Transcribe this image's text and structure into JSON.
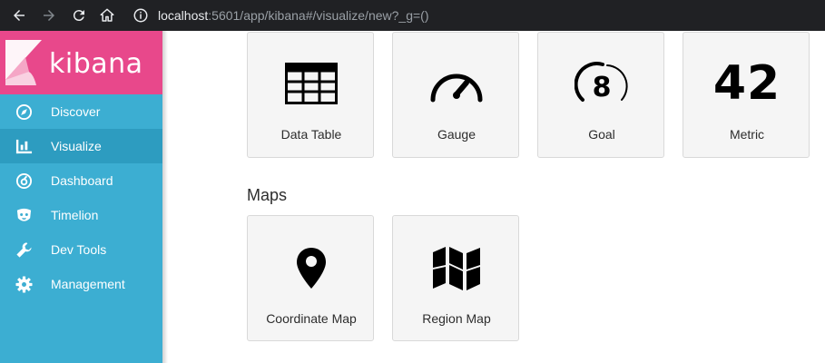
{
  "browser": {
    "url_host": "localhost",
    "url_rest": ":5601/app/kibana#/visualize/new?_g=()"
  },
  "app": {
    "logo_text": "kibana",
    "brand_color": "#e8488b",
    "sidebar_color": "#3caed2"
  },
  "sidebar": {
    "items": [
      {
        "label": "Discover",
        "icon": "compass-icon"
      },
      {
        "label": "Visualize",
        "icon": "bar-chart-icon",
        "active": true
      },
      {
        "label": "Dashboard",
        "icon": "dashboard-icon"
      },
      {
        "label": "Timelion",
        "icon": "timelion-icon"
      },
      {
        "label": "Dev Tools",
        "icon": "wrench-icon"
      },
      {
        "label": "Management",
        "icon": "gear-icon"
      }
    ]
  },
  "main": {
    "data_cards": [
      {
        "label": "Data Table",
        "icon": "table-icon"
      },
      {
        "label": "Gauge",
        "icon": "gauge-icon"
      },
      {
        "label": "Goal",
        "icon": "goal-icon",
        "icon_text": "8"
      },
      {
        "label": "Metric",
        "icon": "metric-icon",
        "icon_text": "42"
      }
    ],
    "maps_title": "Maps",
    "map_cards": [
      {
        "label": "Coordinate Map",
        "icon": "map-pin-icon"
      },
      {
        "label": "Region Map",
        "icon": "region-map-icon"
      }
    ]
  }
}
